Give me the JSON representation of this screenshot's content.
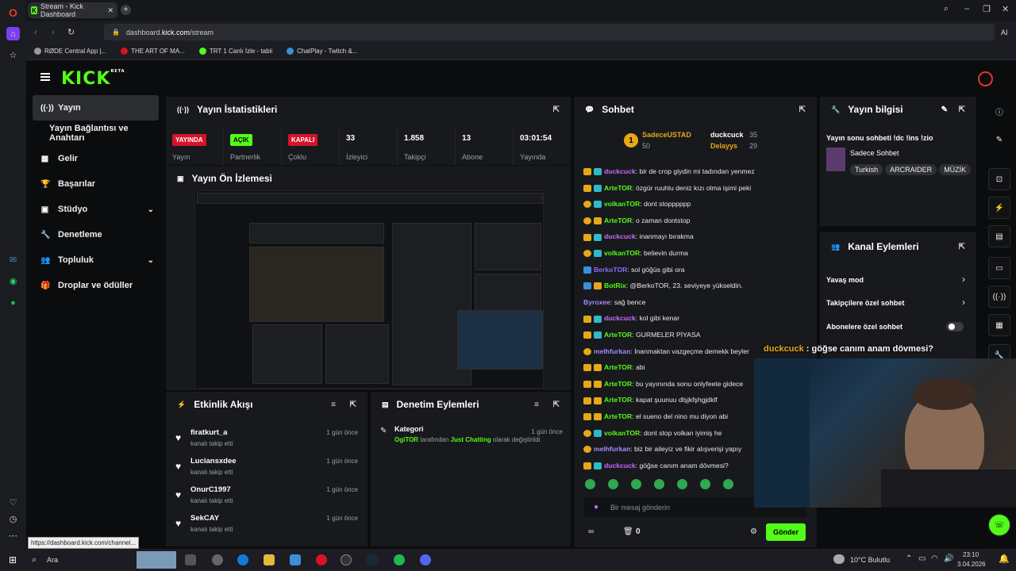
{
  "browser": {
    "tab_title": "Stream - Kick Dashboard",
    "url_prefix": "dashboard.",
    "url_domain": "kick.com",
    "url_path": "/stream",
    "ai_label": "AI",
    "status_url": "https://dashboard.kick.com/channel..."
  },
  "bookmarks": [
    "RØDE Central App |...",
    "THE ART OF MA...",
    "TRT 1 Canlı İzle - tabii",
    "ChatPlay - Twitch &..."
  ],
  "logo": "KICK",
  "logo_sup": "BETA",
  "nav": [
    {
      "label": "Yayın"
    },
    {
      "label": "Yayın Bağlantısı ve Anahtarı"
    },
    {
      "label": "Gelir"
    },
    {
      "label": "Başarılar"
    },
    {
      "label": "Stüdyo"
    },
    {
      "label": "Denetleme"
    },
    {
      "label": "Topluluk"
    },
    {
      "label": "Droplar ve ödüller"
    }
  ],
  "stats_panel": {
    "title": "Yayın İstatistikleri",
    "items": [
      {
        "value": "YAYINDA",
        "label": "Yayın"
      },
      {
        "value": "AÇIK",
        "label": "Partnerlik"
      },
      {
        "value": "KAPALI",
        "label": "Çoklu"
      },
      {
        "value": "33",
        "label": "İzleyici"
      },
      {
        "value": "1.858",
        "label": "Takipçi"
      },
      {
        "value": "13",
        "label": "Abone"
      },
      {
        "value": "03:01:54",
        "label": "Yayında"
      }
    ]
  },
  "preview_panel": {
    "title": "Yayın Ön İzlemesi"
  },
  "events_panel": {
    "title": "Etkinlik Akışı",
    "items": [
      {
        "name": "firatkurt_a",
        "sub": "kanalı takip etti",
        "time": "1 gün önce"
      },
      {
        "name": "Luciansxdee",
        "sub": "kanalı takip etti",
        "time": "1 gün önce"
      },
      {
        "name": "OnurC1997",
        "sub": "kanalı takip etti",
        "time": "1 gün önce"
      },
      {
        "name": "SekCAY",
        "sub": "kanalı takip etti",
        "time": "1 gün önce"
      }
    ]
  },
  "moderation_panel": {
    "title": "Denetim Eylemleri",
    "item_title": "Kategori",
    "item_user": "OgiTOR",
    "item_mid": " tarafından ",
    "item_cat": "Just Chatting",
    "item_end": " olarak değiştirildi",
    "time": "1 gün önce"
  },
  "chat": {
    "title": "Sohbet",
    "top": [
      {
        "name": "SadeceUSTAD",
        "value": "50"
      },
      {
        "name": "duckcuck",
        "value": "35"
      },
      {
        "name": "Delayys",
        "value": "29"
      }
    ],
    "messages": [
      {
        "user": "duckcuck",
        "color": "#c76bff",
        "text": "bir de crop giydin mi tadından yenmez",
        "badges": [
          "gold",
          "cyan"
        ]
      },
      {
        "user": "ArteTOR",
        "color": "#53fc18",
        "text": "özgür ruuhlu deniz kızı olma işimi peki",
        "badges": [
          "gold",
          "cyan"
        ]
      },
      {
        "user": "volkanTOR",
        "color": "#53fc18",
        "text": "dont stopppppp",
        "badges": [
          "coin",
          "cyan"
        ]
      },
      {
        "user": "ArteTOR",
        "color": "#53fc18",
        "text": "o zaman dontstop",
        "badges": [
          "coin",
          "gold"
        ]
      },
      {
        "user": "duckcuck",
        "color": "#c76bff",
        "text": "inanmayı bırakma",
        "badges": [
          "gold",
          "cyan"
        ]
      },
      {
        "user": "volkanTOR",
        "color": "#53fc18",
        "text": "believin durma",
        "badges": [
          "coin",
          "cyan"
        ]
      },
      {
        "user": "BerkoTOR",
        "color": "#8b6bff",
        "text": "sol göğüs gibi ora",
        "badges": [
          "blue"
        ]
      },
      {
        "user": "BotRix",
        "color": "#53fc18",
        "text": "@BerkoTOR, 23. seviyeye yükseldin.",
        "badges": [
          "blue",
          "gold"
        ]
      },
      {
        "user": "Byroxee",
        "color": "#a48bff",
        "text": "sağ bence",
        "badges": []
      },
      {
        "user": "duckcuck",
        "color": "#c76bff",
        "text": "kol gibi kenar",
        "badges": [
          "gold",
          "cyan"
        ]
      },
      {
        "user": "ArteTOR",
        "color": "#53fc18",
        "text": "GURMELER PİYASA",
        "badges": [
          "gold",
          "cyan"
        ]
      },
      {
        "user": "melhfurkan",
        "color": "#a48bff",
        "text": "İnanmaktan vazgeçme demekk beyler",
        "badges": [
          "coin"
        ]
      },
      {
        "user": "ArteTOR",
        "color": "#53fc18",
        "text": "abi",
        "badges": [
          "gold",
          "gold"
        ]
      },
      {
        "user": "ArteTOR",
        "color": "#53fc18",
        "text": "bu yayınında sonu onlyfeete gidece",
        "badges": [
          "gold",
          "gold"
        ]
      },
      {
        "user": "ArteTOR",
        "color": "#53fc18",
        "text": "kapat şuunuu dlşjkfşhgjdklf",
        "badges": [
          "gold",
          "gold"
        ]
      },
      {
        "user": "ArteTOR",
        "color": "#53fc18",
        "text": "el sueno del nino mu diyon abi",
        "badges": [
          "gold",
          "gold"
        ]
      },
      {
        "user": "volkanTOR",
        "color": "#53fc18",
        "text": "dont stop volkan iyimiş he",
        "badges": [
          "coin",
          "cyan"
        ]
      },
      {
        "user": "melhfurkan",
        "color": "#a48bff",
        "text": "biz bir aileyiz ve fikir alışverişi yapıy",
        "badges": [
          "coin"
        ]
      },
      {
        "user": "duckcuck",
        "color": "#c76bff",
        "text": "göğse canım anam dövmesi?",
        "badges": [
          "gold",
          "cyan"
        ]
      }
    ],
    "input_placeholder": "Bir mesaj gönderin",
    "count": "0",
    "send": "Gönder",
    "overlay_user": "duckcuck",
    "overlay_text": "göğse canım anam dövmesi?"
  },
  "info_panel": {
    "title": "Yayın bilgisi",
    "stream_title": "Yayın sonu sohbeti !dc !ins !zio",
    "category": "Sadece Sohbet",
    "tags": [
      "Turkish",
      "ARCRAIDER",
      "MÜZİK"
    ]
  },
  "actions_panel": {
    "title": "Kanal Eylemleri",
    "items": [
      "Yavaş mod",
      "Takipçilere özel sohbet",
      "Abonelere özel sohbet"
    ]
  },
  "taskbar": {
    "search": "Ara",
    "weather": "10°C Bulutlu",
    "time": "23:10",
    "date": "3.04.2026"
  }
}
